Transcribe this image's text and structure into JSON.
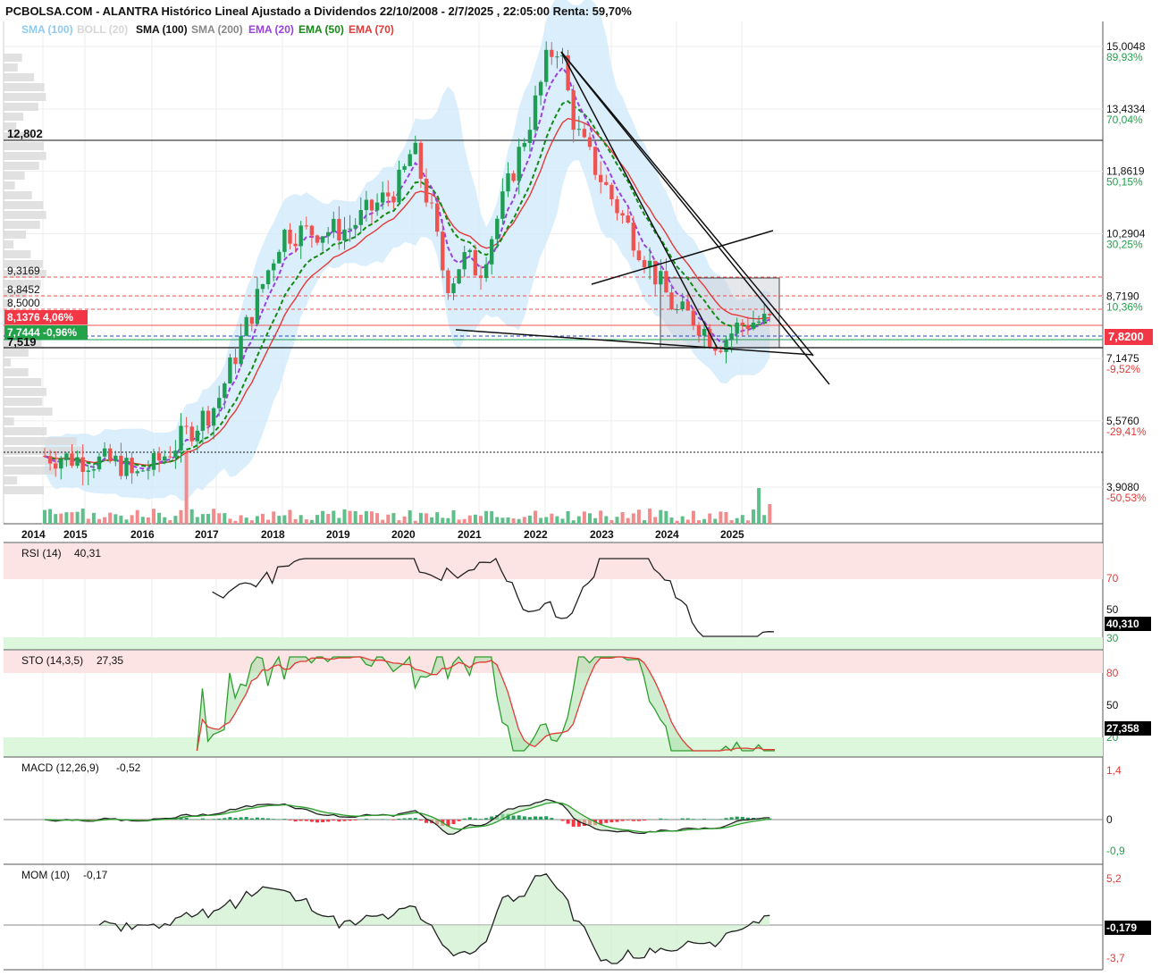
{
  "header": {
    "title": "PCBOLSA.COM - ALANTRA Histórico Lineal Ajustado a Dividendos 22/10/2008 - 2/7/2025 , 22:05:00 Renta: 59,70%"
  },
  "legend": [
    {
      "label": "SMA (100)",
      "color": "#8ecbf2"
    },
    {
      "label": "BOLL (20)",
      "color": "#d6d6d6"
    },
    {
      "label": "SMA (100)",
      "color": "#111111"
    },
    {
      "label": "SMA (200)",
      "color": "#888888"
    },
    {
      "label": "EMA (20)",
      "color": "#9b3fe0"
    },
    {
      "label": "EMA (50)",
      "color": "#138a13"
    },
    {
      "label": "EMA (70)",
      "color": "#e53935"
    }
  ],
  "price_axis": [
    {
      "value": "15,0048",
      "pct": "89,93%",
      "pct_color": "#22a34a"
    },
    {
      "value": "13,4334",
      "pct": "70,04%",
      "pct_color": "#22a34a"
    },
    {
      "value": "11,8619",
      "pct": "50,15%",
      "pct_color": "#22a34a"
    },
    {
      "value": "10,2904",
      "pct": "30,25%",
      "pct_color": "#22a34a"
    },
    {
      "value": "8,7190",
      "pct": "10,36%",
      "pct_color": "#22a34a"
    },
    {
      "value": "7,1475",
      "pct": "-9,52%",
      "pct_color": "#e53935"
    },
    {
      "value": "5,5760",
      "pct": "-29,41%",
      "pct_color": "#e53935"
    },
    {
      "value": "3,9080",
      "pct": "-50,53%",
      "pct_color": "#e53935"
    }
  ],
  "last_price": "7,8200",
  "level_labels": {
    "l12802": "12,802",
    "l93169": "9,3169",
    "l88452": "8,8452",
    "l85000": "8,5000",
    "l7519": "7,519"
  },
  "price_tags": {
    "red": "8,1376  4,06%",
    "green": "7,7444  -0,96%"
  },
  "colors": {
    "up": "#1f9d55",
    "down": "#ef5350",
    "boll_fill": "#cfe8fb",
    "accent_red": "#f23645",
    "accent_green": "#22a34a"
  },
  "years": [
    "2014",
    "2015",
    "2016",
    "2017",
    "2018",
    "2019",
    "2020",
    "2021",
    "2022",
    "2023",
    "2024",
    "2025"
  ],
  "rsi": {
    "title": "RSI (14)",
    "value": "40,31",
    "last": "40,310",
    "axis": [
      "70",
      "50",
      "30"
    ]
  },
  "sto": {
    "title": "STO (14,3,5)",
    "value": "27,35",
    "last": "27,358",
    "axis": [
      "80",
      "50",
      "20"
    ]
  },
  "macd": {
    "title": "MACD (12,26,9)",
    "value": "-0,52",
    "axis": [
      "1,4",
      "0",
      "-0,9"
    ]
  },
  "mom": {
    "title": "MOM (10)",
    "value": "-0,17",
    "last": "-0,179",
    "axis": [
      "5,2",
      "-3,7"
    ]
  },
  "chart_data": {
    "type": "candlestick",
    "title": "PCBOLSA.COM - ALANTRA Histórico Lineal Ajustado a Dividendos 22/10/2008 - 2/7/2025 , 22:05:00 Renta: 59,70%",
    "x_range": [
      "2014",
      "2025"
    ],
    "y_range": [
      3.908,
      15.0048
    ],
    "yearly_price_path": [
      {
        "x": "2014",
        "y": 4.7
      },
      {
        "x": "2015",
        "y": 4.6
      },
      {
        "x": "2016",
        "y": 4.4
      },
      {
        "x": "2017",
        "y": 6.0
      },
      {
        "x": "2018",
        "y": 10.3
      },
      {
        "x": "2019",
        "y": 10.4
      },
      {
        "x": "2020",
        "y": 11.8
      },
      {
        "x": "2021",
        "y": 9.3
      },
      {
        "x": "2022",
        "y": 14.3
      },
      {
        "x": "2023",
        "y": 11.2
      },
      {
        "x": "2024",
        "y": 8.3
      },
      {
        "x": "2025",
        "y": 8.1
      }
    ],
    "last": 7.82,
    "horizontal_levels": [
      12.802,
      9.3169,
      8.8452,
      8.5,
      8.1376,
      7.7444,
      7.519
    ],
    "indicators": {
      "RSI (14)": 40.31,
      "STO (14,3,5)": 27.35,
      "MACD (12,26,9)": -0.52,
      "MOM (10)": -0.17
    }
  }
}
